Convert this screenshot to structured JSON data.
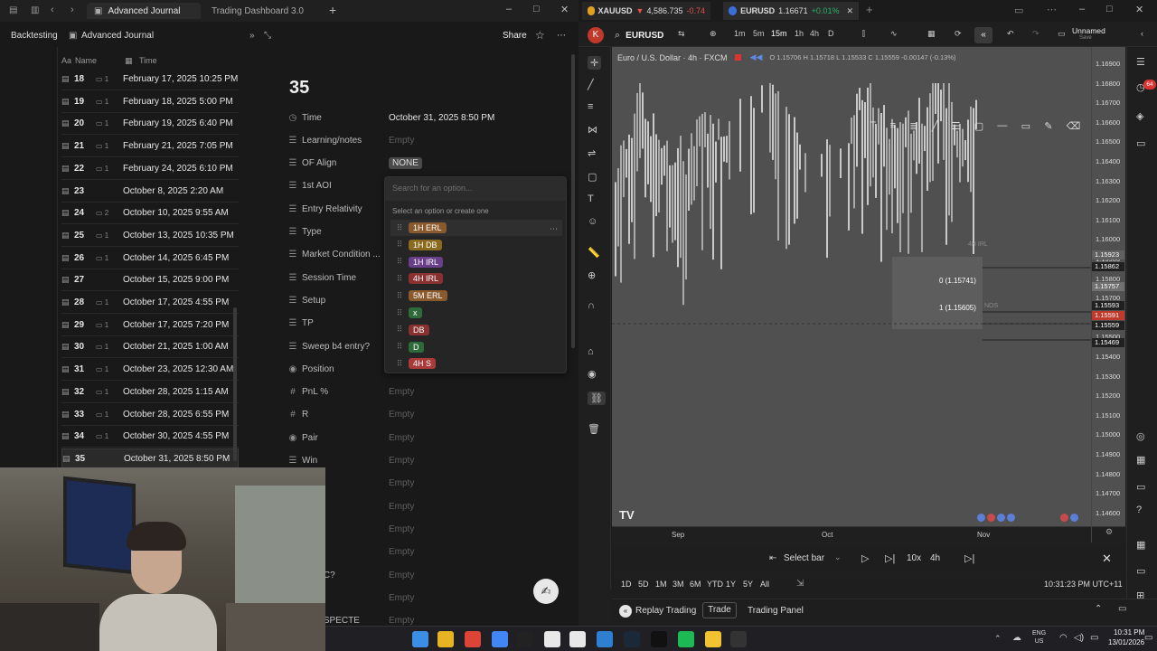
{
  "notion": {
    "tabs": [
      {
        "label": "Advanced Journal"
      },
      {
        "label": "Trading Dashboard 3.0"
      }
    ],
    "breadcrumb": {
      "first": "Backtesting",
      "second": "Advanced Journal"
    },
    "share_label": "Share",
    "columns": {
      "name": "Name",
      "time": "Time"
    },
    "rows": [
      {
        "num": "18",
        "comments": "1",
        "time": "February 17, 2025 10:25 PM"
      },
      {
        "num": "19",
        "comments": "1",
        "time": "February 18, 2025 5:00 PM"
      },
      {
        "num": "20",
        "comments": "1",
        "time": "February 19, 2025 6:40 PM"
      },
      {
        "num": "21",
        "comments": "1",
        "time": "February 21, 2025 7:05 PM"
      },
      {
        "num": "22",
        "comments": "1",
        "time": "February 24, 2025 6:10 PM"
      },
      {
        "num": "23",
        "comments": "",
        "time": "October 8, 2025 2:20 AM"
      },
      {
        "num": "24",
        "comments": "2",
        "time": "October 10, 2025 9:55 AM"
      },
      {
        "num": "25",
        "comments": "1",
        "time": "October 13, 2025 10:35 PM"
      },
      {
        "num": "26",
        "comments": "1",
        "time": "October 14, 2025 6:45 PM"
      },
      {
        "num": "27",
        "comments": "",
        "time": "October 15, 2025 9:00 PM"
      },
      {
        "num": "28",
        "comments": "1",
        "time": "October 17, 2025 4:55 PM"
      },
      {
        "num": "29",
        "comments": "1",
        "time": "October 17, 2025 7:20 PM"
      },
      {
        "num": "30",
        "comments": "1",
        "time": "October 21, 2025 1:00 AM"
      },
      {
        "num": "31",
        "comments": "1",
        "time": "October 23, 2025 12:30 AM"
      },
      {
        "num": "32",
        "comments": "1",
        "time": "October 28, 2025 1:15 AM"
      },
      {
        "num": "33",
        "comments": "1",
        "time": "October 28, 2025 6:55 PM"
      },
      {
        "num": "34",
        "comments": "1",
        "time": "October 30, 2025 4:55 PM"
      },
      {
        "num": "35",
        "comments": "",
        "time": "October 31, 2025 8:50 PM"
      }
    ],
    "page_title": "35",
    "properties": [
      {
        "name": "Time",
        "value": "October 31, 2025 8:50 PM"
      },
      {
        "name": "Learning/notes",
        "value": "Empty"
      },
      {
        "name": "OF Align",
        "value": "NONE"
      },
      {
        "name": "1st AOI",
        "value": ""
      },
      {
        "name": "Entry Relativity",
        "value": ""
      },
      {
        "name": "Type",
        "value": ""
      },
      {
        "name": "Market Condition ...",
        "value": ""
      },
      {
        "name": "Session Time",
        "value": ""
      },
      {
        "name": "Setup",
        "value": ""
      },
      {
        "name": "TP",
        "value": ""
      },
      {
        "name": "Sweep b4 entry?",
        "value": ""
      },
      {
        "name": "Position",
        "value": ""
      },
      {
        "name": "PnL %",
        "value": "Empty"
      },
      {
        "name": "R",
        "value": "Empty"
      },
      {
        "name": "Pair",
        "value": "Empty"
      },
      {
        "name": "Win",
        "value": "Empty"
      },
      {
        "name": "",
        "value": "Empty"
      },
      {
        "name": "nt",
        "value": "Empty"
      },
      {
        "name": "",
        "value": "Empty"
      },
      {
        "name": "",
        "value": "Empty"
      },
      {
        "name": "w PDC?",
        "value": "Empty"
      },
      {
        "name": "l",
        "value": "Empty"
      },
      {
        "name": "N RESPECTE",
        "value": "Empty"
      }
    ],
    "dropdown": {
      "placeholder": "Search for an option...",
      "hint": "Select an option or create one",
      "options": [
        {
          "label": "1H ERL",
          "color": "#8a5a2c"
        },
        {
          "label": "1H DB",
          "color": "#8a6a1e"
        },
        {
          "label": "1H IRL",
          "color": "#6a3f8a"
        },
        {
          "label": "4H IRL",
          "color": "#8a3030"
        },
        {
          "label": "5M ERL",
          "color": "#8a5a2c"
        },
        {
          "label": "x",
          "color": "#2f6b3a"
        },
        {
          "label": "DB",
          "color": "#8a3030"
        },
        {
          "label": "D",
          "color": "#2f6b3a"
        },
        {
          "label": "4H S",
          "color": "#a83a3a"
        }
      ]
    }
  },
  "tradingview": {
    "tabs": [
      {
        "symbol": "XAUUSD",
        "price": "4,586.735",
        "change": "-0.74"
      },
      {
        "symbol": "EURUSD",
        "price": "1.16671",
        "change": "+0.01%"
      }
    ],
    "symbol_search": "EURUSD",
    "timeframes": [
      "1m",
      "5m",
      "15m",
      "1h",
      "4h",
      "D"
    ],
    "layout_name": "Unnamed",
    "layout_sub": "Save",
    "chart_title": "Euro / U.S. Dollar · 4h · FXCM",
    "ohlc": "O 1.15706 H 1.15718 L 1.15533 C 1.15559 -0.00147 (-0.13%)",
    "price_scale": [
      "1.16900",
      "1.16800",
      "1.16700",
      "1.16600",
      "1.16500",
      "1.16400",
      "1.16300",
      "1.16200",
      "1.16100",
      "1.16000",
      "1.15900",
      "1.15800",
      "1.15700",
      "1.15600",
      "1.15500",
      "1.15400",
      "1.15300",
      "1.15200",
      "1.15100",
      "1.15000",
      "1.14900",
      "1.14800",
      "1.14700",
      "1.14600",
      "1.14500"
    ],
    "price_labels": [
      {
        "text": "1.15923",
        "color": "#606060"
      },
      {
        "text": "1.15862",
        "color": "#202020"
      },
      {
        "text": "1.15757",
        "color": "#707070"
      },
      {
        "text": "1.15593",
        "color": "#202020"
      },
      {
        "text": "1.15591",
        "color": "#c0392b"
      },
      {
        "text": "1.15559",
        "color": "#202020"
      },
      {
        "text": "1.15469",
        "color": "#202020"
      }
    ],
    "fib_labels": [
      "0 (1.15741)",
      "1 (1.15605)"
    ],
    "annotations": [
      "4H IRL",
      "NOS"
    ],
    "time_axis": [
      "Sep",
      "Oct",
      "Nov"
    ],
    "replay": {
      "select_bar": "Select bar",
      "speed": "10x",
      "interval": "4h"
    },
    "ranges": [
      "1D",
      "5D",
      "1M",
      "3M",
      "6M",
      "YTD",
      "1Y",
      "5Y",
      "All"
    ],
    "clock": "10:31:23 PM UTC+11",
    "bottom": {
      "replay": "Replay Trading",
      "trade": "Trade",
      "panel": "Trading Panel"
    },
    "notif_count": "64"
  },
  "taskbar": {
    "lang": "ENG\nUS",
    "time": "10:31 PM",
    "date": "13/01/2026"
  }
}
